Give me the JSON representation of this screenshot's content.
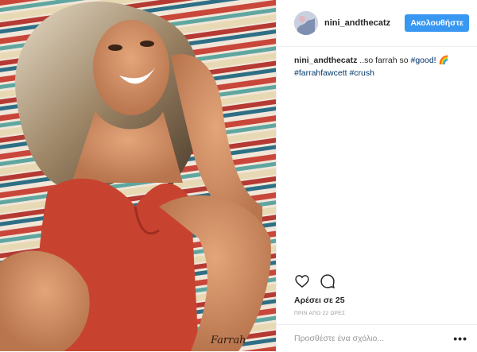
{
  "post": {
    "username": "nini_andthecatz",
    "follow_label": "Ακολουθήστε",
    "caption": {
      "username": "nini_andthecatz",
      "text": " ..so farrah so ",
      "tag_good": "#good!",
      "emoji": "🌈",
      "tag_farrah": "#farrahfawcett",
      "tag_crush": "#crush"
    },
    "likes": "Αρέσει σε 25",
    "time_ago": "ΠΡΙΝ ΑΠΟ 22 ΩΡΕΣ",
    "comment_placeholder": "Προσθέστε ένα σχόλιο...",
    "more_label": "•••",
    "photo_signature": "Farrah"
  },
  "icons": {
    "like": "heart-icon",
    "comment": "comment-icon",
    "more": "more-options-icon"
  }
}
